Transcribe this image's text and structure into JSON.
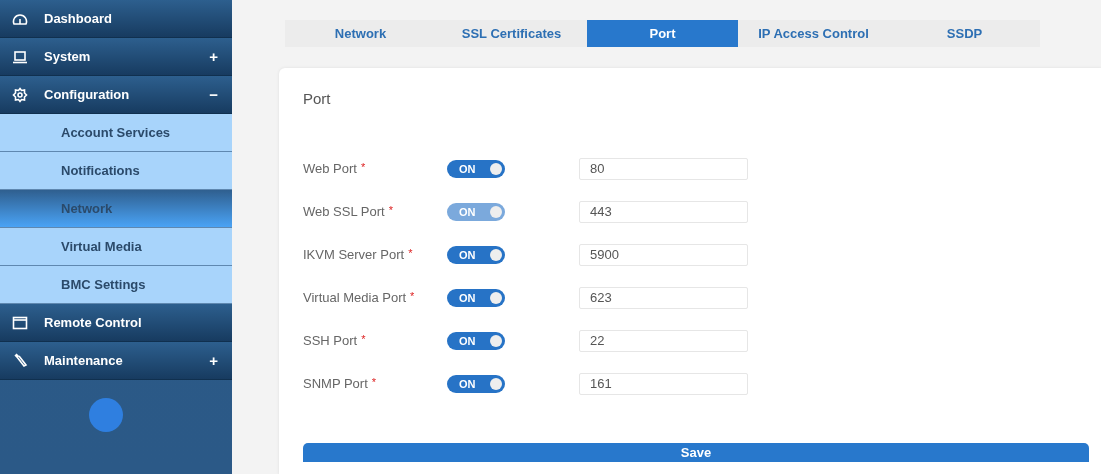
{
  "sidebar": {
    "items": [
      {
        "kind": "section",
        "label": "Dashboard"
      },
      {
        "kind": "section",
        "label": "System",
        "sign": "+"
      },
      {
        "kind": "section",
        "label": "Configuration",
        "sign": "−",
        "children": [
          {
            "label": "Account Services",
            "selected": false
          },
          {
            "label": "Notifications",
            "selected": false
          },
          {
            "label": "Network",
            "selected": true
          },
          {
            "label": "Virtual Media",
            "selected": false
          },
          {
            "label": "BMC Settings",
            "selected": false
          }
        ]
      },
      {
        "kind": "section",
        "label": "Remote Control"
      },
      {
        "kind": "section",
        "label": "Maintenance",
        "sign": "+"
      }
    ]
  },
  "tabs": [
    {
      "label": "Network",
      "selected": false
    },
    {
      "label": "SSL Certificates",
      "selected": false
    },
    {
      "label": "Port",
      "selected": true
    },
    {
      "label": "IP Access Control",
      "selected": false
    },
    {
      "label": "SSDP",
      "selected": false
    }
  ],
  "panel": {
    "title": "Port",
    "rows": [
      {
        "label": "Web Port",
        "required": "*",
        "toggle": "ON",
        "on": true,
        "disabled": false,
        "value": "80"
      },
      {
        "label": "Web SSL Port",
        "required": "*",
        "toggle": "ON",
        "on": true,
        "disabled": true,
        "value": "443"
      },
      {
        "label": "IKVM Server Port",
        "required": "*",
        "toggle": "ON",
        "on": true,
        "disabled": false,
        "value": "5900"
      },
      {
        "label": "Virtual Media Port",
        "required": "*",
        "toggle": "ON",
        "on": true,
        "disabled": false,
        "value": "623"
      },
      {
        "label": "SSH Port",
        "required": "*",
        "toggle": "ON",
        "on": true,
        "disabled": false,
        "value": "22"
      },
      {
        "label": "SNMP Port",
        "required": "*",
        "toggle": "ON",
        "on": true,
        "disabled": false,
        "value": "161"
      }
    ],
    "save": "Save"
  }
}
